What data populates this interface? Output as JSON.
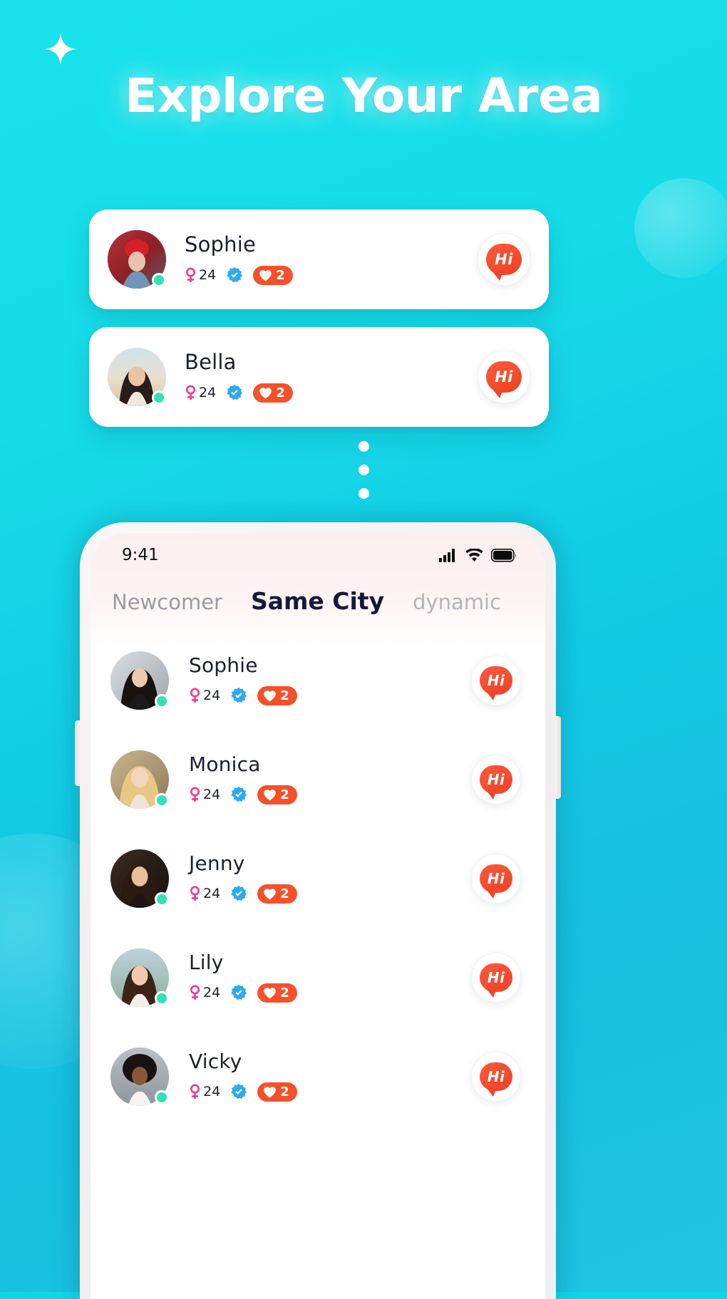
{
  "theme": {
    "bg_start": "#19e3ea",
    "bg_end": "#1ec6e2",
    "accent_red": "#f4512a",
    "verified_blue": "#2eaaf0",
    "online_green": "#2fe3b4",
    "female_pink": "#ef3b8f",
    "name_color": "#1b1f33",
    "tab_active_color": "#15193a",
    "tab_inactive_color": "#9b9ba2"
  },
  "header": {
    "title": "Explore Your Area",
    "sparkle_icon": "sparkle-icon"
  },
  "floating_cards": [
    {
      "name": "Sophie",
      "age": "24",
      "gender_icon": "female-icon",
      "verified_icon": "verified-badge-icon",
      "likes": "2",
      "like_icon": "heart-icon",
      "action_label": "Hi",
      "online": true,
      "photo": "sophie-red-hat"
    },
    {
      "name": "Bella",
      "age": "24",
      "gender_icon": "female-icon",
      "verified_icon": "verified-badge-icon",
      "likes": "2",
      "like_icon": "heart-icon",
      "action_label": "Hi",
      "online": true,
      "photo": "bella-beach"
    }
  ],
  "scroll_dots": [
    "dot",
    "dot",
    "dot"
  ],
  "phone": {
    "status_bar": {
      "time": "9:41",
      "signal_icon": "cellular-signal-icon",
      "wifi_icon": "wifi-icon",
      "battery_icon": "battery-full-icon"
    },
    "tabs": [
      {
        "label": "Newcomer",
        "active": false
      },
      {
        "label": "Same City",
        "active": true
      },
      {
        "label": "dynamic",
        "active": false
      }
    ],
    "list": [
      {
        "name": "Sophie",
        "age": "24",
        "likes": "2",
        "action_label": "Hi",
        "online": true,
        "photo": "sophie-dark-top"
      },
      {
        "name": "Monica",
        "age": "24",
        "likes": "2",
        "action_label": "Hi",
        "online": true,
        "photo": "monica-blonde"
      },
      {
        "name": "Jenny",
        "age": "24",
        "likes": "2",
        "action_label": "Hi",
        "online": true,
        "photo": "jenny-brunette"
      },
      {
        "name": "Lily",
        "age": "24",
        "likes": "2",
        "action_label": "Hi",
        "online": true,
        "photo": "lily-smiling"
      },
      {
        "name": "Vicky",
        "age": "24",
        "likes": "2",
        "action_label": "Hi",
        "online": true,
        "photo": "vicky-curly"
      }
    ]
  }
}
